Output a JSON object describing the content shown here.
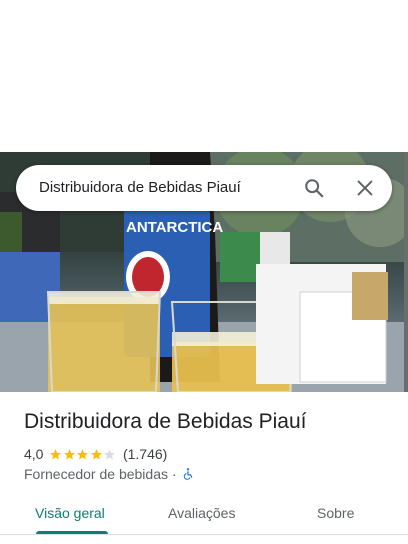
{
  "search": {
    "query": "Distribuidora de Bebidas Piauí"
  },
  "place": {
    "name": "Distribuidora de Bebidas Piauí",
    "rating": "4,0",
    "rating_value": 4.0,
    "rating_max": 5,
    "review_count": "(1.746)",
    "category": "Fornecedor de bebidas",
    "separator": "·",
    "accessibility_icon": "wheelchair-icon"
  },
  "photo": {
    "can_label": "ANTARCTICA"
  },
  "tabs": [
    {
      "label": "Visão geral",
      "selected": true
    },
    {
      "label": "Avaliações",
      "selected": false
    },
    {
      "label": "Sobre",
      "selected": false
    }
  ],
  "colors": {
    "accent": "#0b7d74",
    "star": "#fbbc04",
    "star_empty": "#dadce0",
    "accessibility": "#1a73e8"
  }
}
